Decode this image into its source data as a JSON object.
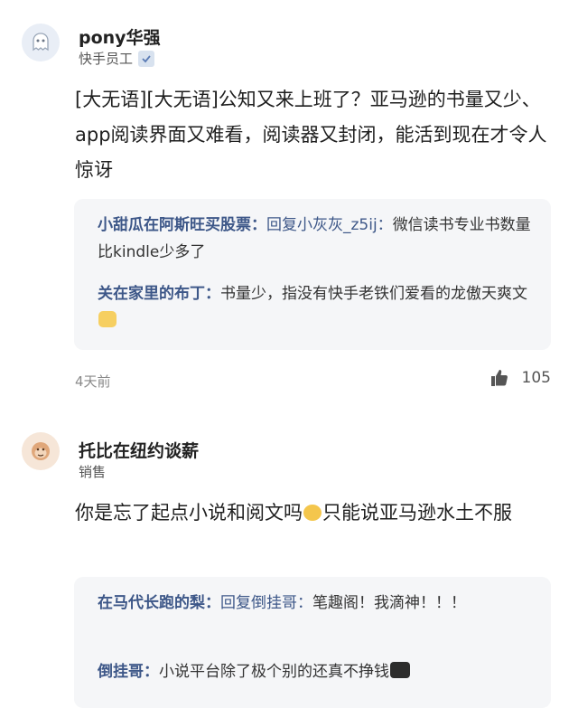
{
  "comments": [
    {
      "username": "pony华强",
      "role": "快手员工",
      "text": "[大无语][大无语]公知又来上班了？亚马逊的书量又少、app阅读界面又难看，阅读器又封闭，能活到现在才令人惊讶",
      "replies": [
        {
          "name": "小甜瓜在阿斯旺买股票：",
          "reply_to": "回复小灰灰_z5ij：",
          "text": "微信读书专业书数量比kindle少多了"
        },
        {
          "name": "关在家里的布丁：",
          "text": "书量少，指没有快手老铁们爱看的龙傲天爽文"
        }
      ],
      "time": "4天前",
      "likes": "105"
    },
    {
      "username": "托比在纽约谈薪",
      "role": "销售",
      "text_part1": "你是忘了起点小说和阅文吗",
      "text_part2": "只能说亚马逊水土不服",
      "replies": [
        {
          "name": "在马代长跑的梨：",
          "reply_to": "回复倒挂哥：",
          "text": "笔趣阁！我滴神！！！"
        },
        {
          "name": "倒挂哥：",
          "text": "小说平台除了极个别的还真不挣钱"
        }
      ]
    }
  ],
  "icons": {
    "avatar1": "ghost-avatar-icon",
    "avatar2": "monkey-avatar-icon",
    "verify": "verified-badge-icon",
    "like": "thumbs-up-icon",
    "emoji_blush": "blush-emoji-icon",
    "emoji_laugh": "laughing-tears-emoji-icon",
    "emoji_dark": "sunglasses-emoji-icon"
  },
  "colors": {
    "reply_name": "#3d5788",
    "reply_bg": "#f5f6f8",
    "meta": "#8a8a8a"
  }
}
